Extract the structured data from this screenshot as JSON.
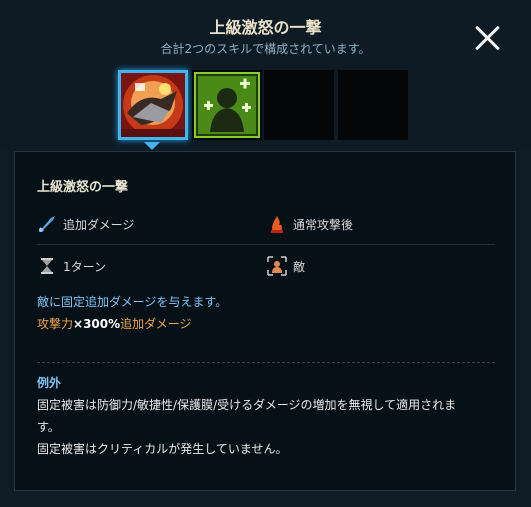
{
  "header": {
    "title": "上級激怒の一撃",
    "subtitle": "合計2つのスキルで構成されています。"
  },
  "skill_slots": [
    {
      "label": "skill-1",
      "selected": true
    },
    {
      "label": "skill-2",
      "selected": false
    },
    {
      "label": "empty",
      "selected": false
    },
    {
      "label": "empty",
      "selected": false
    }
  ],
  "panel": {
    "skill_name": "上級激怒の一撃",
    "effect_type": "追加ダメージ",
    "timing": "通常攻撃後",
    "duration": "1ターン",
    "target": "敵",
    "description": "敵に固定追加ダメージを与えます。",
    "formula_stat": "攻撃力",
    "formula_multiplier": "×300%",
    "formula_suffix": "追加ダメージ",
    "exception_title": "例外",
    "exception_line1": "固定被害は防御力/敏捷性/保護膜/受けるダメージの増加を無視して適用されま",
    "exception_line2": "す。",
    "exception_line3": "固定被害はクリティカルが発生していません。"
  },
  "colors": {
    "accent": "#3fb6f0",
    "info_blue": "#7fc4f0",
    "orange": "#f0a44a",
    "background": "#0f1c26",
    "panel": "#061017"
  }
}
